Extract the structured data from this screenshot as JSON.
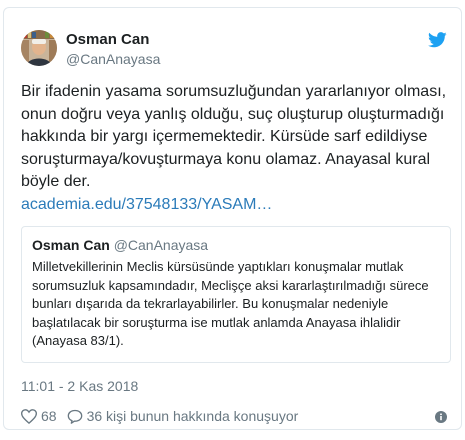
{
  "tweet": {
    "author": {
      "display_name": "Osman Can",
      "handle": "@CanAnayasa",
      "avatar_icon": "user-avatar-photo"
    },
    "brand_icon": "twitter-bird-icon",
    "brand_color": "#1da1f2",
    "text": "Bir ifadenin yasama sorumsuzluğundan yararlanıyor olması, onun doğru veya yanlış olduğu, suç oluşturup oluşturmadığı hakkında bir yargı içermemektedir. Kürsüde sarf edildiyse soruşturmaya/kovuşturmaya konu olamaz. Anayasal kural böyle der.",
    "link_text": "academia.edu/37548133/YASAM…",
    "link_color": "#2b7bb9",
    "quoted_tweet": {
      "display_name": "Osman Can",
      "handle": "@CanAnayasa",
      "text": "Milletvekillerinin Meclis kürsüsünde yaptıkları konuşmalar mutlak sorumsuzluk kapsamındadır, Meclişçe aksi kararlaştırılmadığı sürece bunları dışarıda da tekrarlayabilirler. Bu konuşmalar nedeniyle başlatılacak bir soruşturma ise mutlak anlamda Anayasa ihlalidir (Anayasa 83/1)."
    },
    "timestamp": "11:01 - 2 Kas 2018",
    "likes": "68",
    "replies_text": "36 kişi bunun hakkında konuşuyor",
    "info_icon": "info-icon"
  }
}
